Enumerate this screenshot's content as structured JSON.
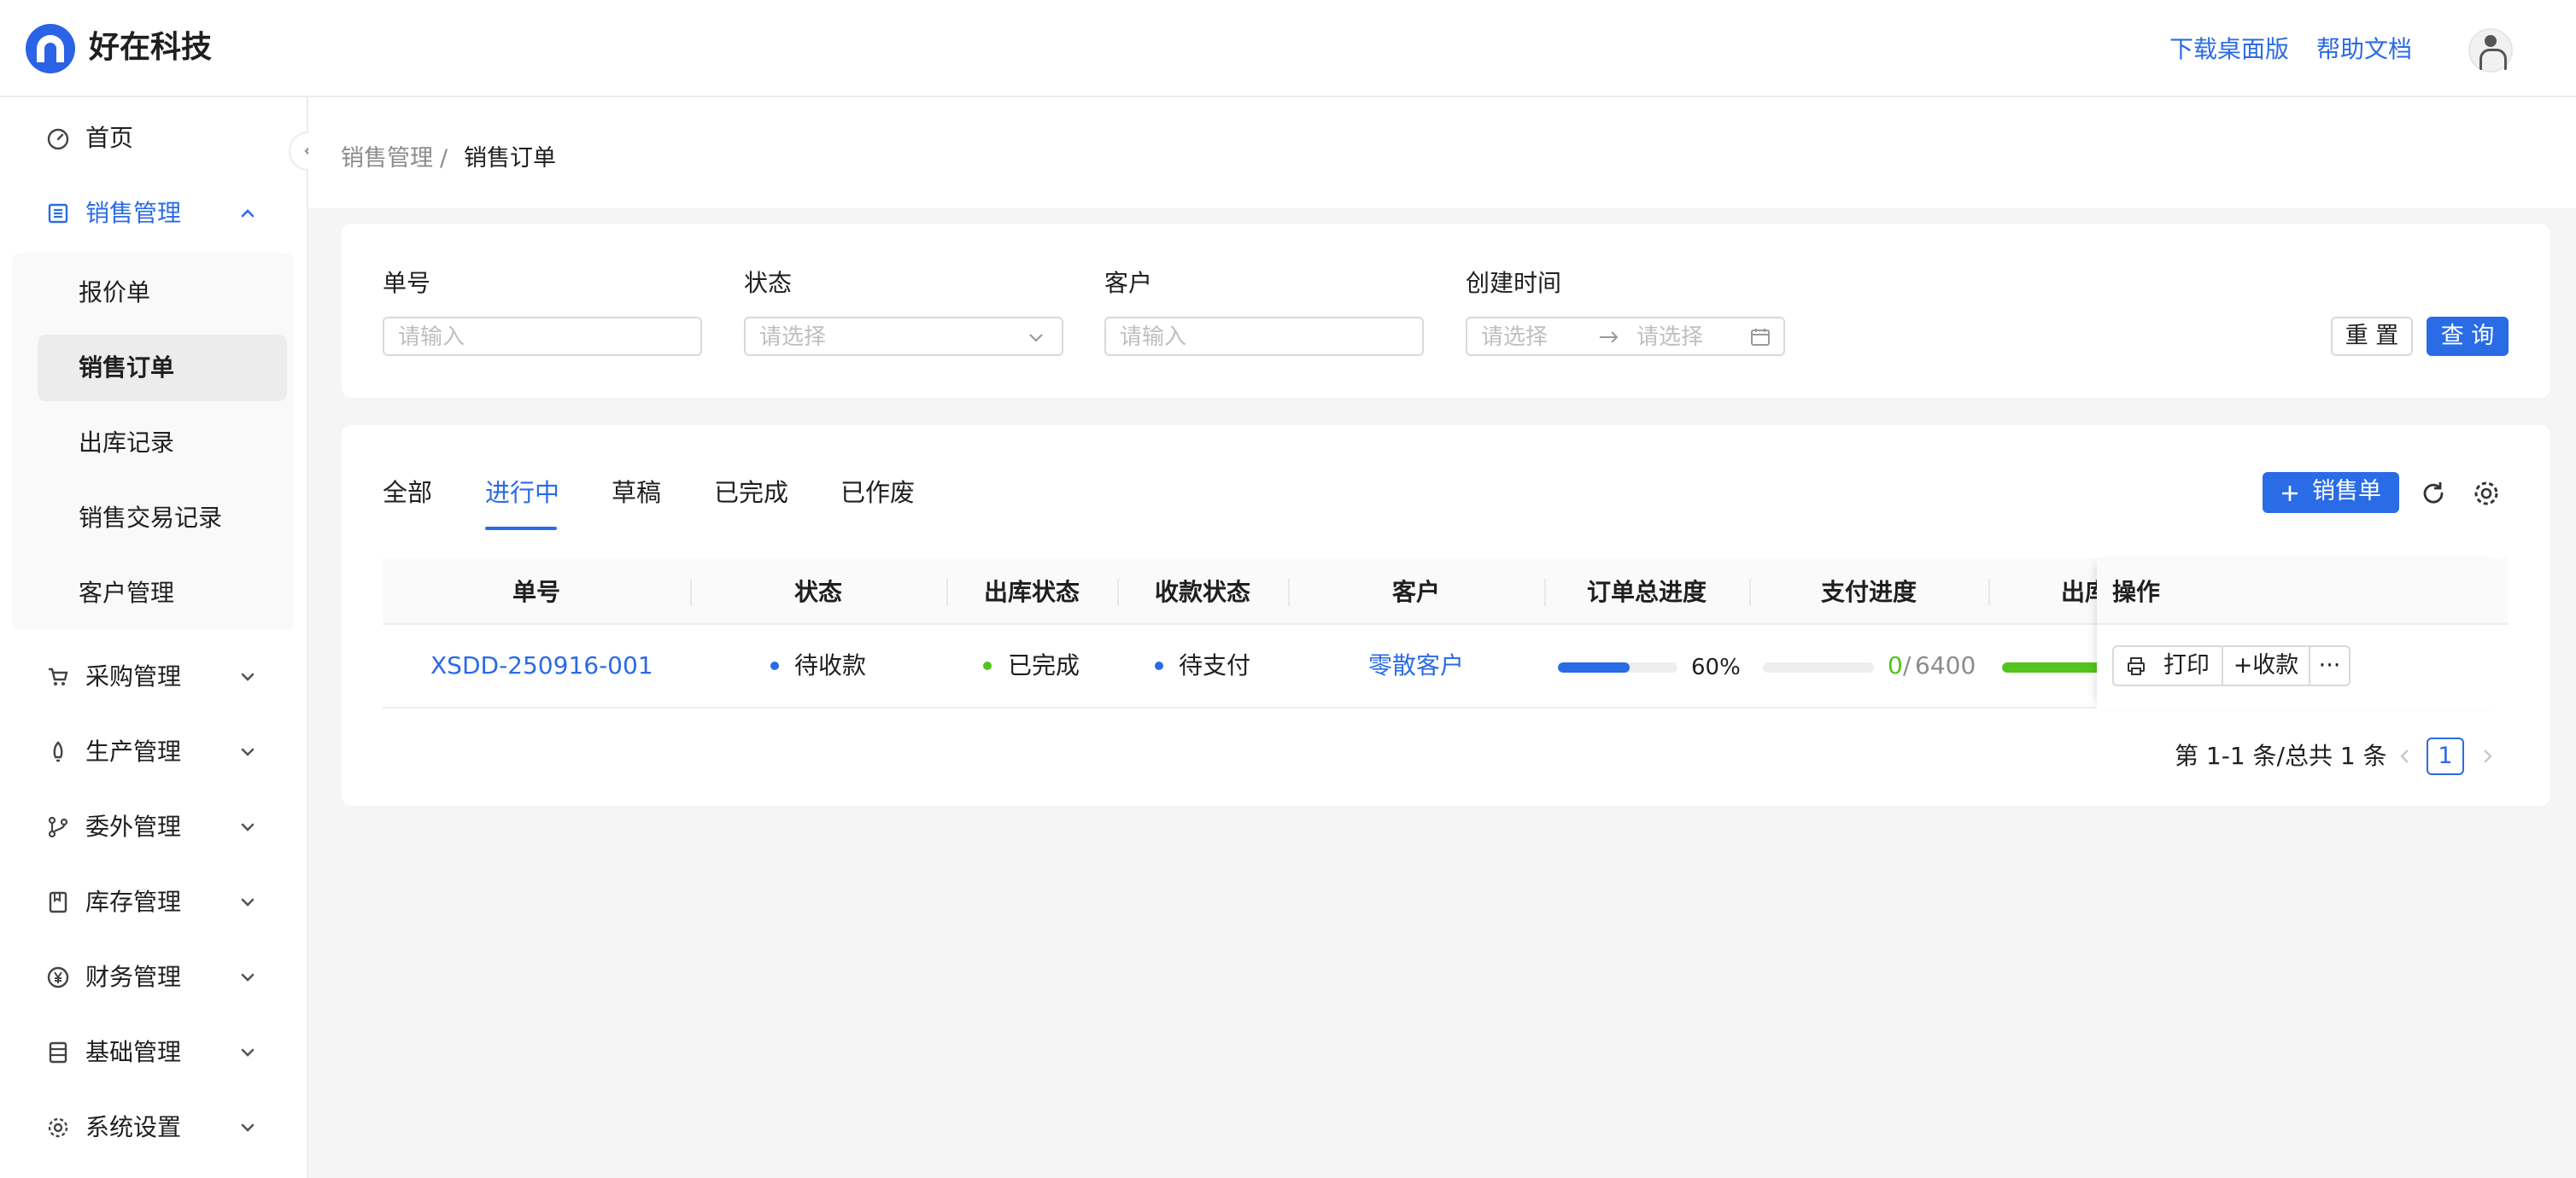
{
  "header": {
    "brand": "好在科技",
    "links": [
      "下载桌面版",
      "帮助文档"
    ]
  },
  "sidebar": {
    "items": [
      {
        "label": "首页",
        "icon": "dashboard-icon"
      },
      {
        "label": "销售管理",
        "icon": "document-list-icon",
        "expanded": true
      },
      {
        "label": "采购管理",
        "icon": "cart-icon"
      },
      {
        "label": "生产管理",
        "icon": "rocket-icon"
      },
      {
        "label": "委外管理",
        "icon": "branch-icon"
      },
      {
        "label": "库存管理",
        "icon": "book-icon"
      },
      {
        "label": "财务管理",
        "icon": "yen-icon"
      },
      {
        "label": "基础管理",
        "icon": "database-icon"
      },
      {
        "label": "系统设置",
        "icon": "gear-icon"
      }
    ],
    "sales_submenu": [
      "报价单",
      "销售订单",
      "出库记录",
      "销售交易记录",
      "客户管理"
    ],
    "selected_submenu": "销售订单"
  },
  "breadcrumb": [
    "销售管理",
    "/",
    "销售订单"
  ],
  "filters": {
    "order_no": {
      "label": "单号",
      "placeholder": "请输入"
    },
    "status": {
      "label": "状态",
      "placeholder": "请选择"
    },
    "customer": {
      "label": "客户",
      "placeholder": "请输入"
    },
    "created": {
      "label": "创建时间",
      "start_placeholder": "请选择",
      "end_placeholder": "请选择"
    },
    "reset_label": "重 置",
    "query_label": "查 询"
  },
  "tabs": [
    "全部",
    "进行中",
    "草稿",
    "已完成",
    "已作废"
  ],
  "active_tab": "进行中",
  "toolbar": {
    "add_label": "销售单"
  },
  "table": {
    "columns": [
      "单号",
      "状态",
      "出库状态",
      "收款状态",
      "客户",
      "订单总进度",
      "支付进度",
      "出库",
      "操作"
    ],
    "rows": [
      {
        "order_no": "XSDD-250916-001",
        "status": "待收款",
        "outbound_status": "已完成",
        "payment_status": "待支付",
        "customer": "零散客户",
        "order_progress_pct": 60,
        "order_progress_text": "60%",
        "paid": "0",
        "pay_sep": "/",
        "pay_total": "6400",
        "outbound_progress": 1.0
      }
    ],
    "actions": [
      "打印",
      "+收款",
      "···"
    ]
  },
  "pagination": {
    "summary": "第 1-1 条/总共 1 条",
    "current_page": "1"
  },
  "colors": {
    "accent": "#2a6be6",
    "success": "#52c41a",
    "info_dot": "#2a6be6"
  }
}
